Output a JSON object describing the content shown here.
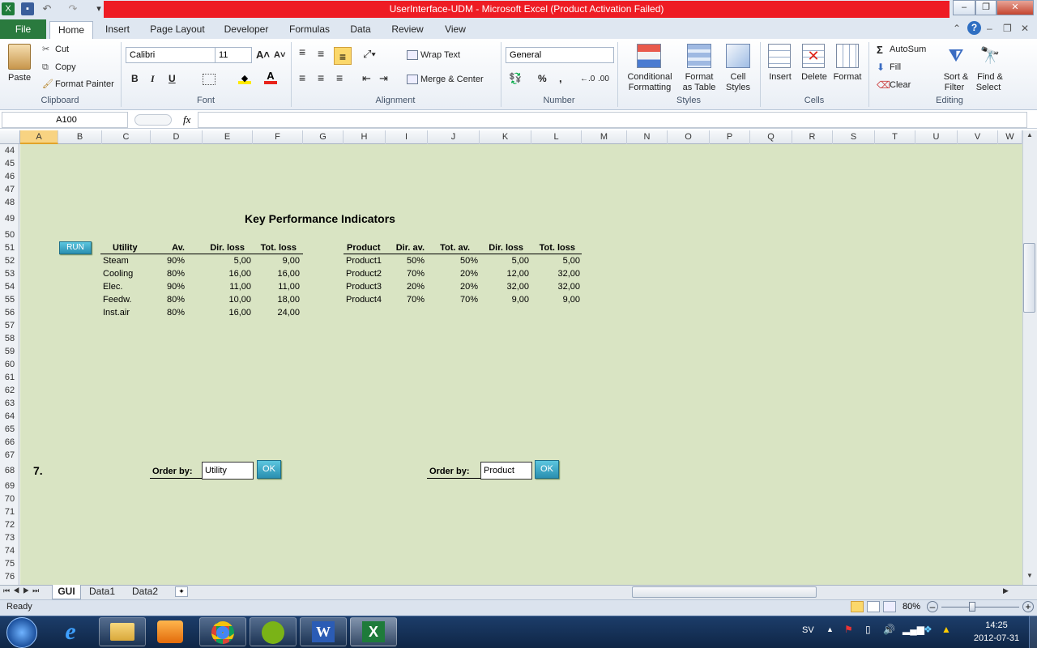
{
  "window": {
    "title": "UserInterface-UDM  -  Microsoft Excel (Product Activation Failed)",
    "accent": "#ee1c24"
  },
  "ribbon_tabs": [
    "File",
    "Home",
    "Insert",
    "Page Layout",
    "Developer",
    "Formulas",
    "Data",
    "Review",
    "View"
  ],
  "clipboard": {
    "paste": "Paste",
    "cut": "Cut",
    "copy": "Copy",
    "format_painter": "Format Painter",
    "label": "Clipboard"
  },
  "font": {
    "name": "Calibri",
    "size": "11",
    "label": "Font",
    "bold": "B",
    "italic": "I",
    "underline": "U"
  },
  "alignment": {
    "wrap": "Wrap Text",
    "merge": "Merge & Center",
    "label": "Alignment"
  },
  "number": {
    "format": "General",
    "label": "Number",
    "percent": "%",
    "comma": ","
  },
  "styles": {
    "conditional": "Conditional",
    "conditional2": "Formatting",
    "format_table": "Format",
    "format_table2": "as Table",
    "cell_styles": "Cell",
    "cell_styles2": "Styles",
    "label": "Styles"
  },
  "cells": {
    "insert": "Insert",
    "delete": "Delete",
    "format": "Format",
    "label": "Cells"
  },
  "editing": {
    "autosum": "AutoSum",
    "fill": "Fill",
    "clear": "Clear",
    "sort": "Sort &",
    "sort2": "Filter",
    "find": "Find &",
    "find2": "Select",
    "label": "Editing"
  },
  "formula_bar": {
    "name_box": "A100",
    "fx": "fx",
    "formula": ""
  },
  "columns": [
    "A",
    "B",
    "C",
    "D",
    "E",
    "F",
    "G",
    "H",
    "I",
    "J",
    "K",
    "L",
    "M",
    "N",
    "O",
    "P",
    "Q",
    "R",
    "S",
    "T",
    "U",
    "V",
    "W"
  ],
  "rows": [
    "44",
    "45",
    "46",
    "47",
    "48",
    "49",
    "50",
    "51",
    "52",
    "53",
    "54",
    "55",
    "56",
    "57",
    "58",
    "59",
    "60",
    "61",
    "62",
    "63",
    "64",
    "65",
    "66",
    "67",
    "68",
    "69",
    "70",
    "71",
    "72",
    "73",
    "74",
    "75",
    "76"
  ],
  "sheet": {
    "title": "Key Performance Indicators",
    "run_button": "RUN",
    "utility_table": {
      "headers": [
        "Utility",
        "Av.",
        "Dir. loss",
        "Tot. loss"
      ],
      "rows": [
        [
          "Steam",
          "90%",
          "5,00",
          "9,00"
        ],
        [
          "Cooling",
          "80%",
          "16,00",
          "16,00"
        ],
        [
          "Elec.",
          "90%",
          "11,00",
          "11,00"
        ],
        [
          "Feedw.",
          "80%",
          "10,00",
          "18,00"
        ],
        [
          "Inst.air",
          "80%",
          "16,00",
          "24,00"
        ]
      ]
    },
    "product_table": {
      "headers": [
        "Product",
        "Dir. av.",
        "Tot. av.",
        "Dir. loss",
        "Tot. loss"
      ],
      "rows": [
        [
          "Product1",
          "50%",
          "50%",
          "5,00",
          "5,00"
        ],
        [
          "Product2",
          "70%",
          "20%",
          "12,00",
          "32,00"
        ],
        [
          "Product3",
          "20%",
          "20%",
          "32,00",
          "32,00"
        ],
        [
          "Product4",
          "70%",
          "70%",
          "9,00",
          "9,00"
        ]
      ]
    },
    "section_number": "7.",
    "order_by_label": "Order by:",
    "order_utility": "Utility",
    "order_product": "Product",
    "ok": "OK",
    "background": "#d9e4c3"
  },
  "sheet_tabs": [
    "GUI",
    "Data1",
    "Data2"
  ],
  "status": {
    "ready": "Ready",
    "zoom": "80%"
  },
  "taskbar": {
    "lang": "SV",
    "time": "14:25",
    "date": "2012-07-31"
  }
}
